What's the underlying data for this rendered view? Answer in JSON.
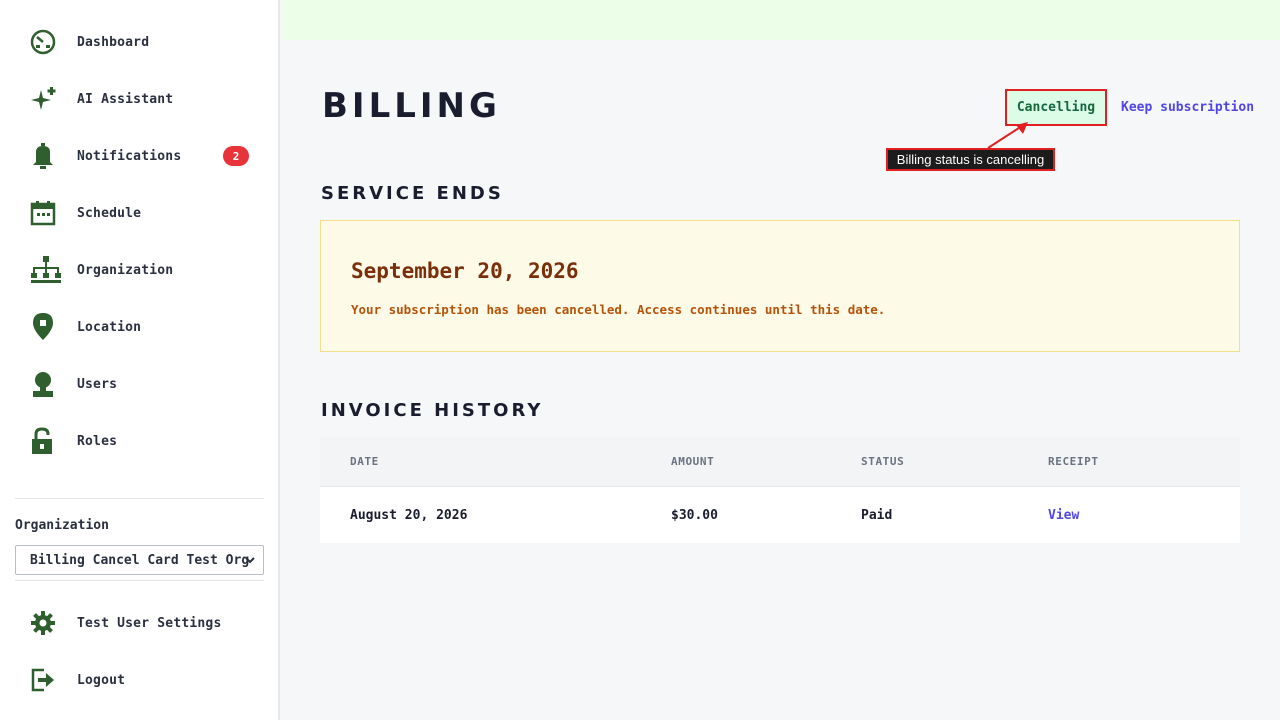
{
  "sidebar": {
    "items": [
      {
        "label": "Dashboard",
        "icon": "dashboard-icon"
      },
      {
        "label": "AI Assistant",
        "icon": "sparkle-icon"
      },
      {
        "label": "Notifications",
        "icon": "bell-icon",
        "badge": "2"
      },
      {
        "label": "Schedule",
        "icon": "calendar-icon"
      },
      {
        "label": "Organization",
        "icon": "org-chart-icon"
      },
      {
        "label": "Location",
        "icon": "map-pin-icon"
      },
      {
        "label": "Users",
        "icon": "user-icon"
      },
      {
        "label": "Roles",
        "icon": "lock-icon"
      }
    ],
    "organization_label": "Organization",
    "organization_selected": "Billing Cancel Card Test Org",
    "settings_label": "Test User Settings",
    "logout_label": "Logout"
  },
  "header": {
    "title": "BILLING",
    "status": "Cancelling",
    "keep_subscription": "Keep subscription",
    "annotation": "Billing status is cancelling"
  },
  "service_ends": {
    "heading": "SERVICE ENDS",
    "date": "September 20, 2026",
    "message": "Your subscription has been cancelled. Access continues until this date."
  },
  "invoice_history": {
    "heading": "INVOICE HISTORY",
    "columns": [
      "DATE",
      "AMOUNT",
      "STATUS",
      "RECEIPT"
    ],
    "rows": [
      {
        "date": "August 20, 2026",
        "amount": "$30.00",
        "status": "Paid",
        "receipt": "View"
      }
    ]
  },
  "colors": {
    "icon_green": "#2f5e2f",
    "badge_red": "#e8333b",
    "link": "#4f46e5",
    "status_bg": "#dcfce7",
    "notice_bg": "#fefae8",
    "annotation_border": "#e02020"
  }
}
